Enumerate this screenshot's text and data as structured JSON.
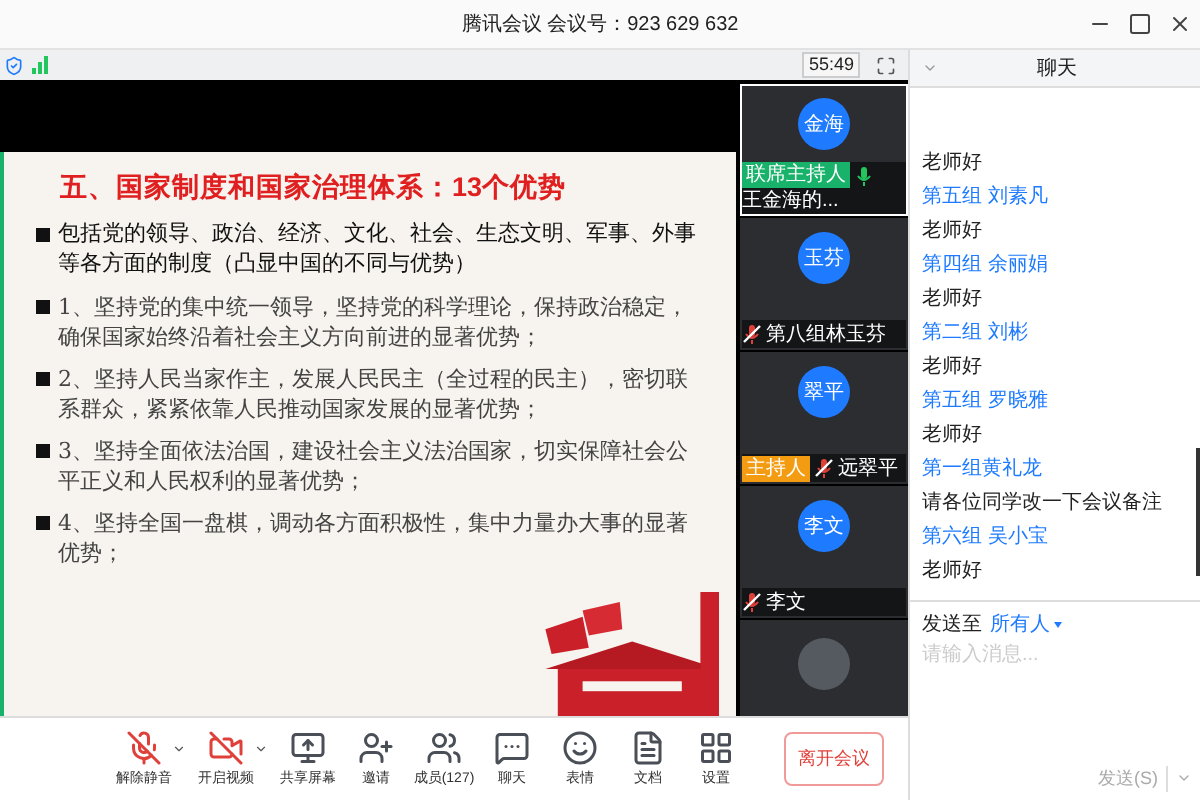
{
  "window": {
    "title": "腾讯会议 会议号：923 629 632"
  },
  "status": {
    "timer": "55:49"
  },
  "slide": {
    "title": "五、国家制度和国家治理体系：13个优势",
    "bullets": [
      {
        "text": "包括党的领导、政治、经济、文化、社会、生态文明、军事、外事等各方面的制度（凸显中国的不同与优势）",
        "kind": "lead"
      },
      {
        "text": "1、坚持党的集中统一领导，坚持党的科学理论，保持政治稳定，确保国家始终沿着社会主义方向前进的显著优势；",
        "kind": "point"
      },
      {
        "text": "2、坚持人民当家作主，发展人民民主（全过程的民主），密切联系群众，紧紧依靠人民推动国家发展的显著优势；",
        "kind": "point"
      },
      {
        "text": "3、坚持全面依法治国，建设社会主义法治国家，切实保障社会公平正义和人民权利的显著优势；",
        "kind": "point"
      },
      {
        "text": "4、坚持全国一盘棋，调动各方面积极性，集中力量办大事的显著优势；",
        "kind": "point"
      }
    ]
  },
  "participants": [
    {
      "kind": "initials",
      "avatar": "金海",
      "role": "联席主持人",
      "name": "王金海的...",
      "muted": false,
      "active": true
    },
    {
      "kind": "initials",
      "avatar": "玉芬",
      "name": "第八组林玉芬",
      "muted": true,
      "active": false
    },
    {
      "kind": "initials",
      "avatar": "翠平",
      "role": "主持人",
      "name": "远翠平",
      "muted": true,
      "active": false
    },
    {
      "kind": "initials",
      "avatar": "李文",
      "name": "李文",
      "muted": true,
      "active": false
    },
    {
      "kind": "photo",
      "active": false
    }
  ],
  "chat": {
    "title": "聊天",
    "messages": [
      {
        "text": "老师好"
      },
      {
        "sender": "第五组 刘素凡",
        "text": "老师好"
      },
      {
        "sender": "第四组 余丽娟",
        "text": "老师好"
      },
      {
        "sender": "第二组 刘彬",
        "text": "老师好"
      },
      {
        "sender": "第五组 罗晓雅",
        "text": "老师好"
      },
      {
        "sender": "第一组黄礼龙",
        "text": "请各位同学改一下会议备注"
      },
      {
        "sender": "第六组 吴小宝",
        "text": "老师好"
      }
    ],
    "send_to_label": "发送至",
    "recipient": "所有人",
    "placeholder": "请输入消息...",
    "send": "发送(S)"
  },
  "toolbar": [
    {
      "kind": "mic",
      "label": "解除静音",
      "off": true
    },
    {
      "kind": "video",
      "label": "开启视频",
      "off": true
    },
    {
      "kind": "share",
      "label": "共享屏幕"
    },
    {
      "kind": "invite",
      "label": "邀请"
    },
    {
      "kind": "members",
      "label": "成员(127)"
    },
    {
      "kind": "chat",
      "label": "聊天"
    },
    {
      "kind": "emoji",
      "label": "表情"
    },
    {
      "kind": "docs",
      "label": "文档"
    },
    {
      "kind": "settings",
      "label": "设置"
    }
  ],
  "leave": "离开会议"
}
